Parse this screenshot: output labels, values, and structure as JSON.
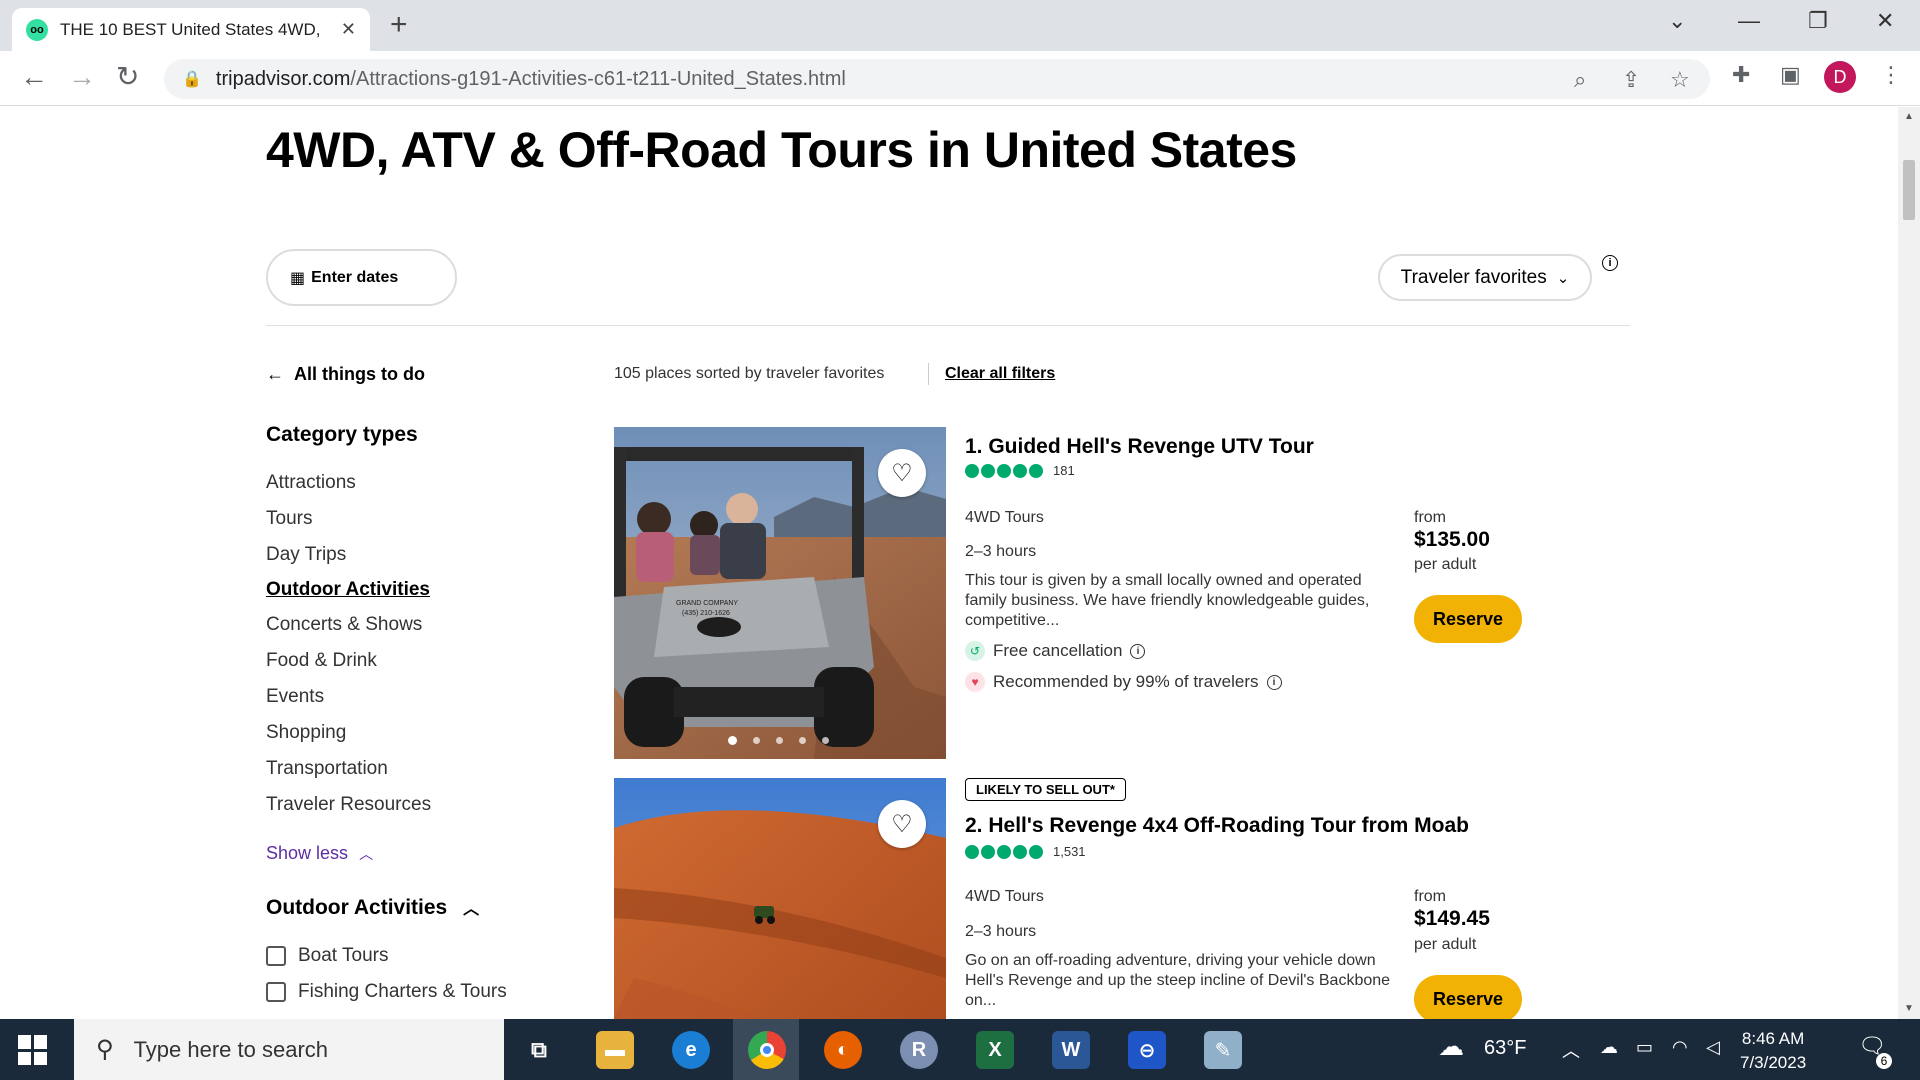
{
  "browser": {
    "tab_title": "THE 10 BEST United States 4WD,",
    "tab_favicon": "tripadvisor-owl-icon",
    "url_host": "tripadvisor.com",
    "url_path": "/Attractions-g191-Activities-c61-t211-United_States.html",
    "profile_initial": "D"
  },
  "page": {
    "title": "4WD, ATV & Off-Road Tours in United States",
    "date_button": "Enter dates",
    "sort_label": "Traveler favorites",
    "results_meta": "105 places sorted by traveler favorites",
    "clear_filters": "Clear all filters",
    "back_link": "All things to do"
  },
  "sidebar": {
    "category_title": "Category types",
    "categories": [
      {
        "label": "Attractions",
        "active": false
      },
      {
        "label": "Tours",
        "active": false
      },
      {
        "label": "Day Trips",
        "active": false
      },
      {
        "label": "Outdoor Activities",
        "active": true
      },
      {
        "label": "Concerts & Shows",
        "active": false
      },
      {
        "label": "Food & Drink",
        "active": false
      },
      {
        "label": "Events",
        "active": false
      },
      {
        "label": "Shopping",
        "active": false
      },
      {
        "label": "Transportation",
        "active": false
      },
      {
        "label": "Traveler Resources",
        "active": false
      }
    ],
    "show_less": "Show less",
    "subsection_title": "Outdoor Activities",
    "checkboxes": [
      "Boat Tours",
      "Fishing Charters & Tours"
    ]
  },
  "listings": [
    {
      "badge": "",
      "title": "1. Guided Hell's Revenge UTV Tour",
      "rating": 5,
      "reviews": "181",
      "type": "4WD Tours",
      "duration": "2–3 hours",
      "description": "This tour is given by a small locally owned and operated family business. We have friendly knowledgeable guides, competitive...",
      "perk1": "Free cancellation",
      "perk2": "Recommended by 99% of travelers",
      "from": "from",
      "price": "$135.00",
      "per": "per adult",
      "reserve": "Reserve",
      "photo_overlay": "GRAND COMPANY (435) 210-1626"
    },
    {
      "badge": "LIKELY TO SELL OUT*",
      "title": "2. Hell's Revenge 4x4 Off-Roading Tour from Moab",
      "rating": 5,
      "reviews": "1,531",
      "type": "4WD Tours",
      "duration": "2–3 hours",
      "description": "Go on an off-roading adventure, driving your vehicle down Hell's Revenge and up the steep incline of Devil's Backbone on...",
      "from": "from",
      "price": "$149.45",
      "per": "per adult",
      "reserve": "Reserve"
    }
  ],
  "taskbar": {
    "search_placeholder": "Type here to search",
    "weather": "63°F",
    "time": "8:46 AM",
    "date": "7/3/2023",
    "notifications": "6"
  },
  "colors": {
    "brand_green": "#00aa6c",
    "reserve_yellow": "#f2b203",
    "link_purple": "#5c2ea5"
  }
}
